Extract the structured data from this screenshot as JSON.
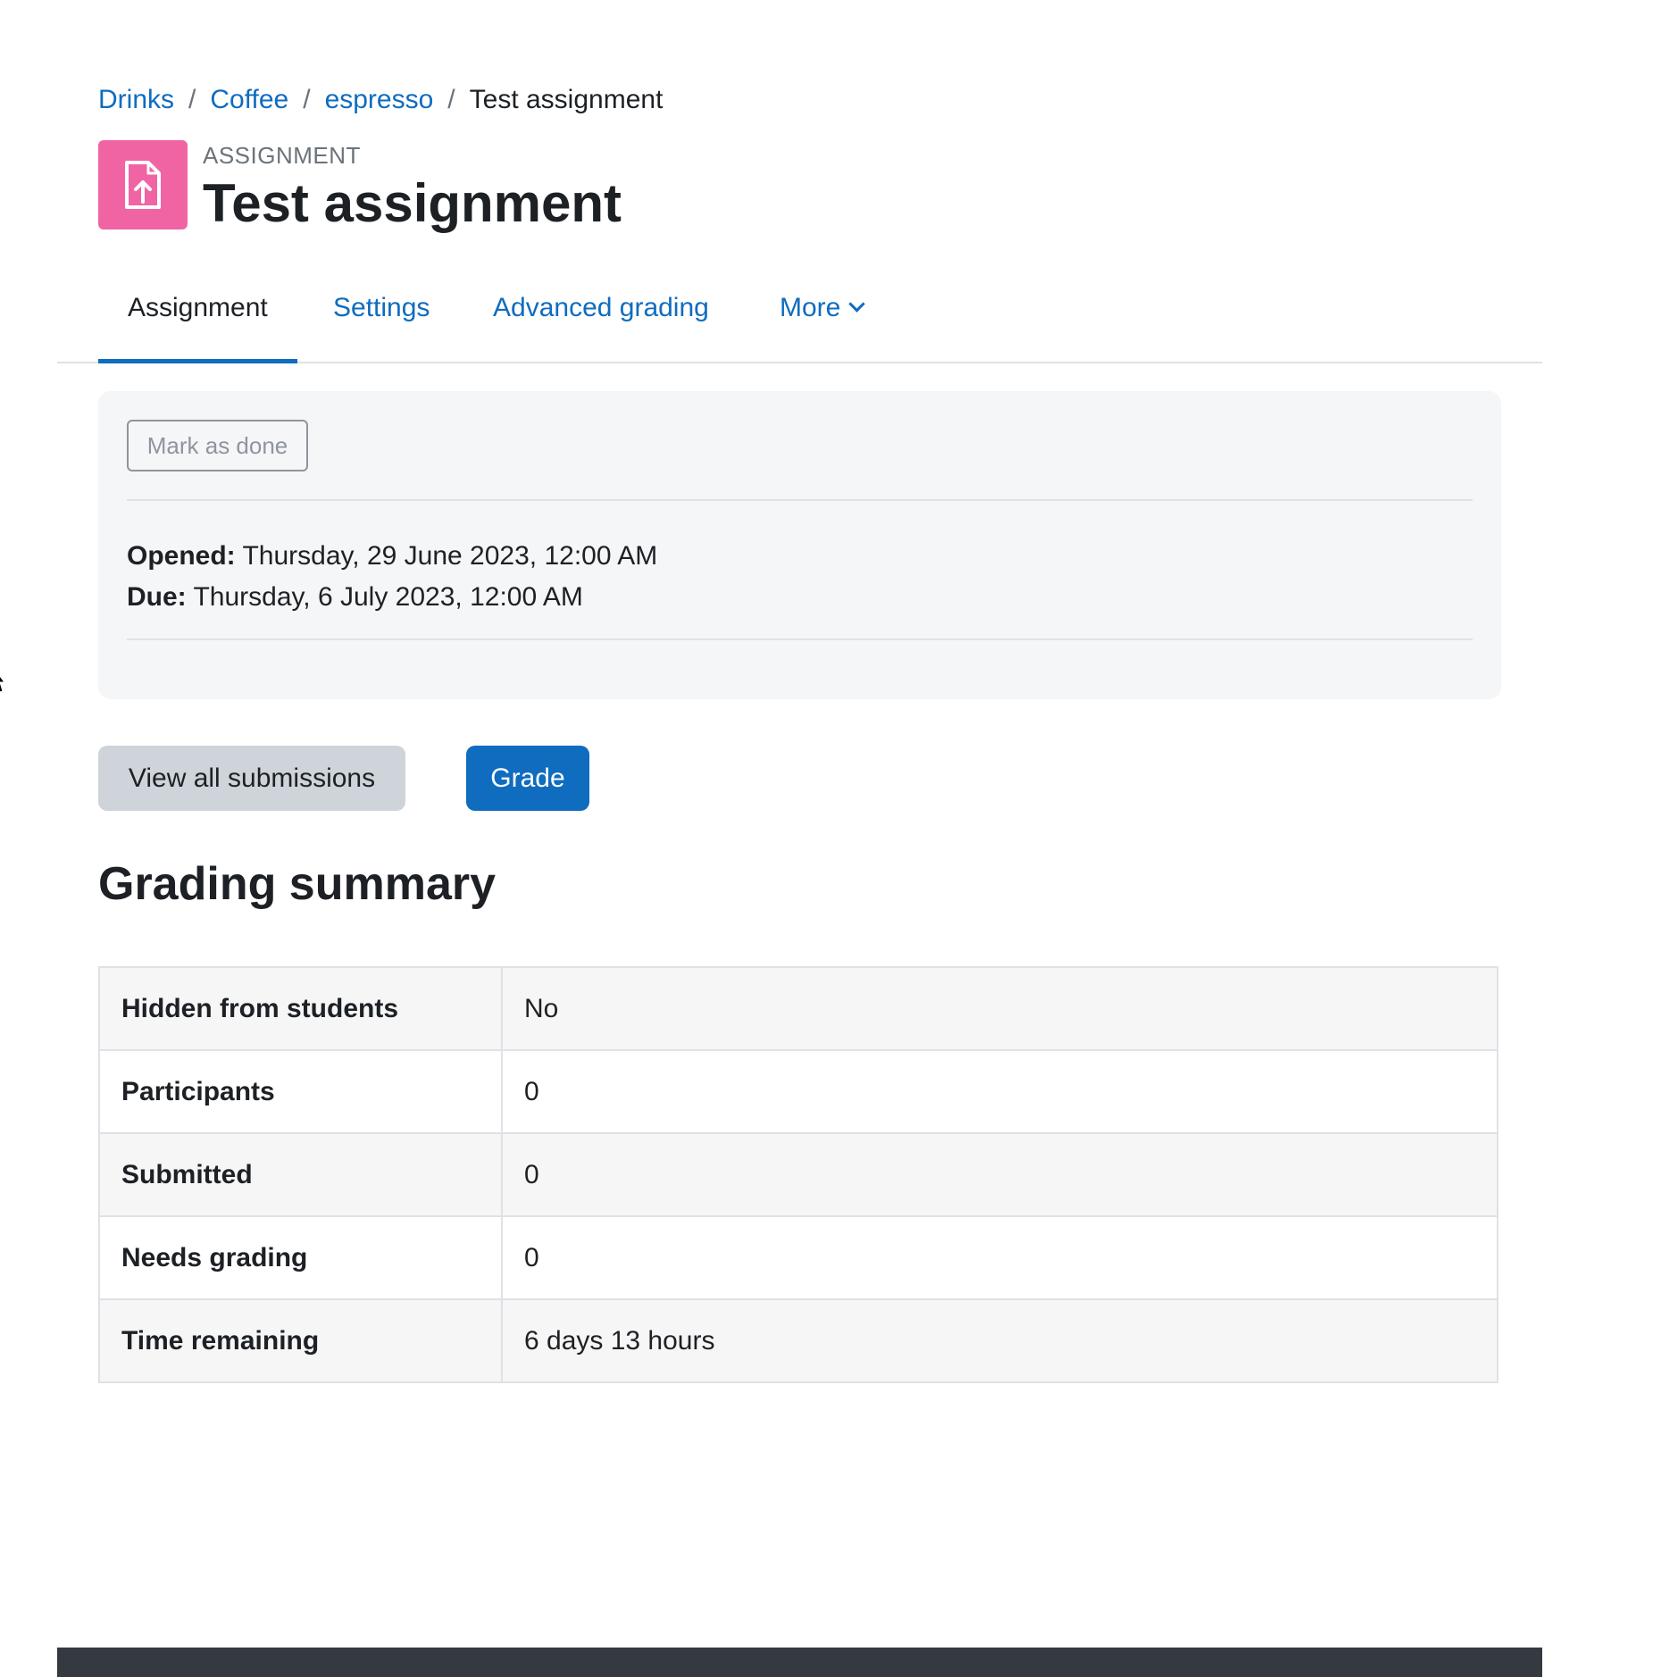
{
  "breadcrumb": {
    "items": [
      {
        "label": "Drinks"
      },
      {
        "label": "Coffee"
      },
      {
        "label": "espresso"
      }
    ],
    "separator": "/",
    "current": "Test assignment"
  },
  "header": {
    "activity_type": "ASSIGNMENT",
    "title": "Test assignment",
    "icon": "assignment-upload-icon",
    "icon_color": "#f064a4"
  },
  "nav": {
    "tabs": [
      {
        "label": "Assignment",
        "active": true
      },
      {
        "label": "Settings"
      },
      {
        "label": "Advanced grading"
      },
      {
        "label": "More"
      }
    ]
  },
  "info": {
    "mark_done_label": "Mark as done",
    "opened_label": "Opened:",
    "opened_value": "Thursday, 29 June 2023, 12:00 AM",
    "due_label": "Due:",
    "due_value": "Thursday, 6 July 2023, 12:00 AM"
  },
  "actions": {
    "view_all_label": "View all submissions",
    "grade_label": "Grade"
  },
  "summary": {
    "title": "Grading summary",
    "rows": [
      {
        "label": "Hidden from students",
        "value": "No"
      },
      {
        "label": "Participants",
        "value": "0"
      },
      {
        "label": "Submitted",
        "value": "0"
      },
      {
        "label": "Needs grading",
        "value": "0"
      },
      {
        "label": "Time remaining",
        "value": "6 days 13 hours"
      }
    ]
  },
  "colors": {
    "link": "#0f6cbf",
    "primary_button": "#0f6cbf",
    "secondary_button": "#ced4da",
    "footer": "#343a40"
  }
}
